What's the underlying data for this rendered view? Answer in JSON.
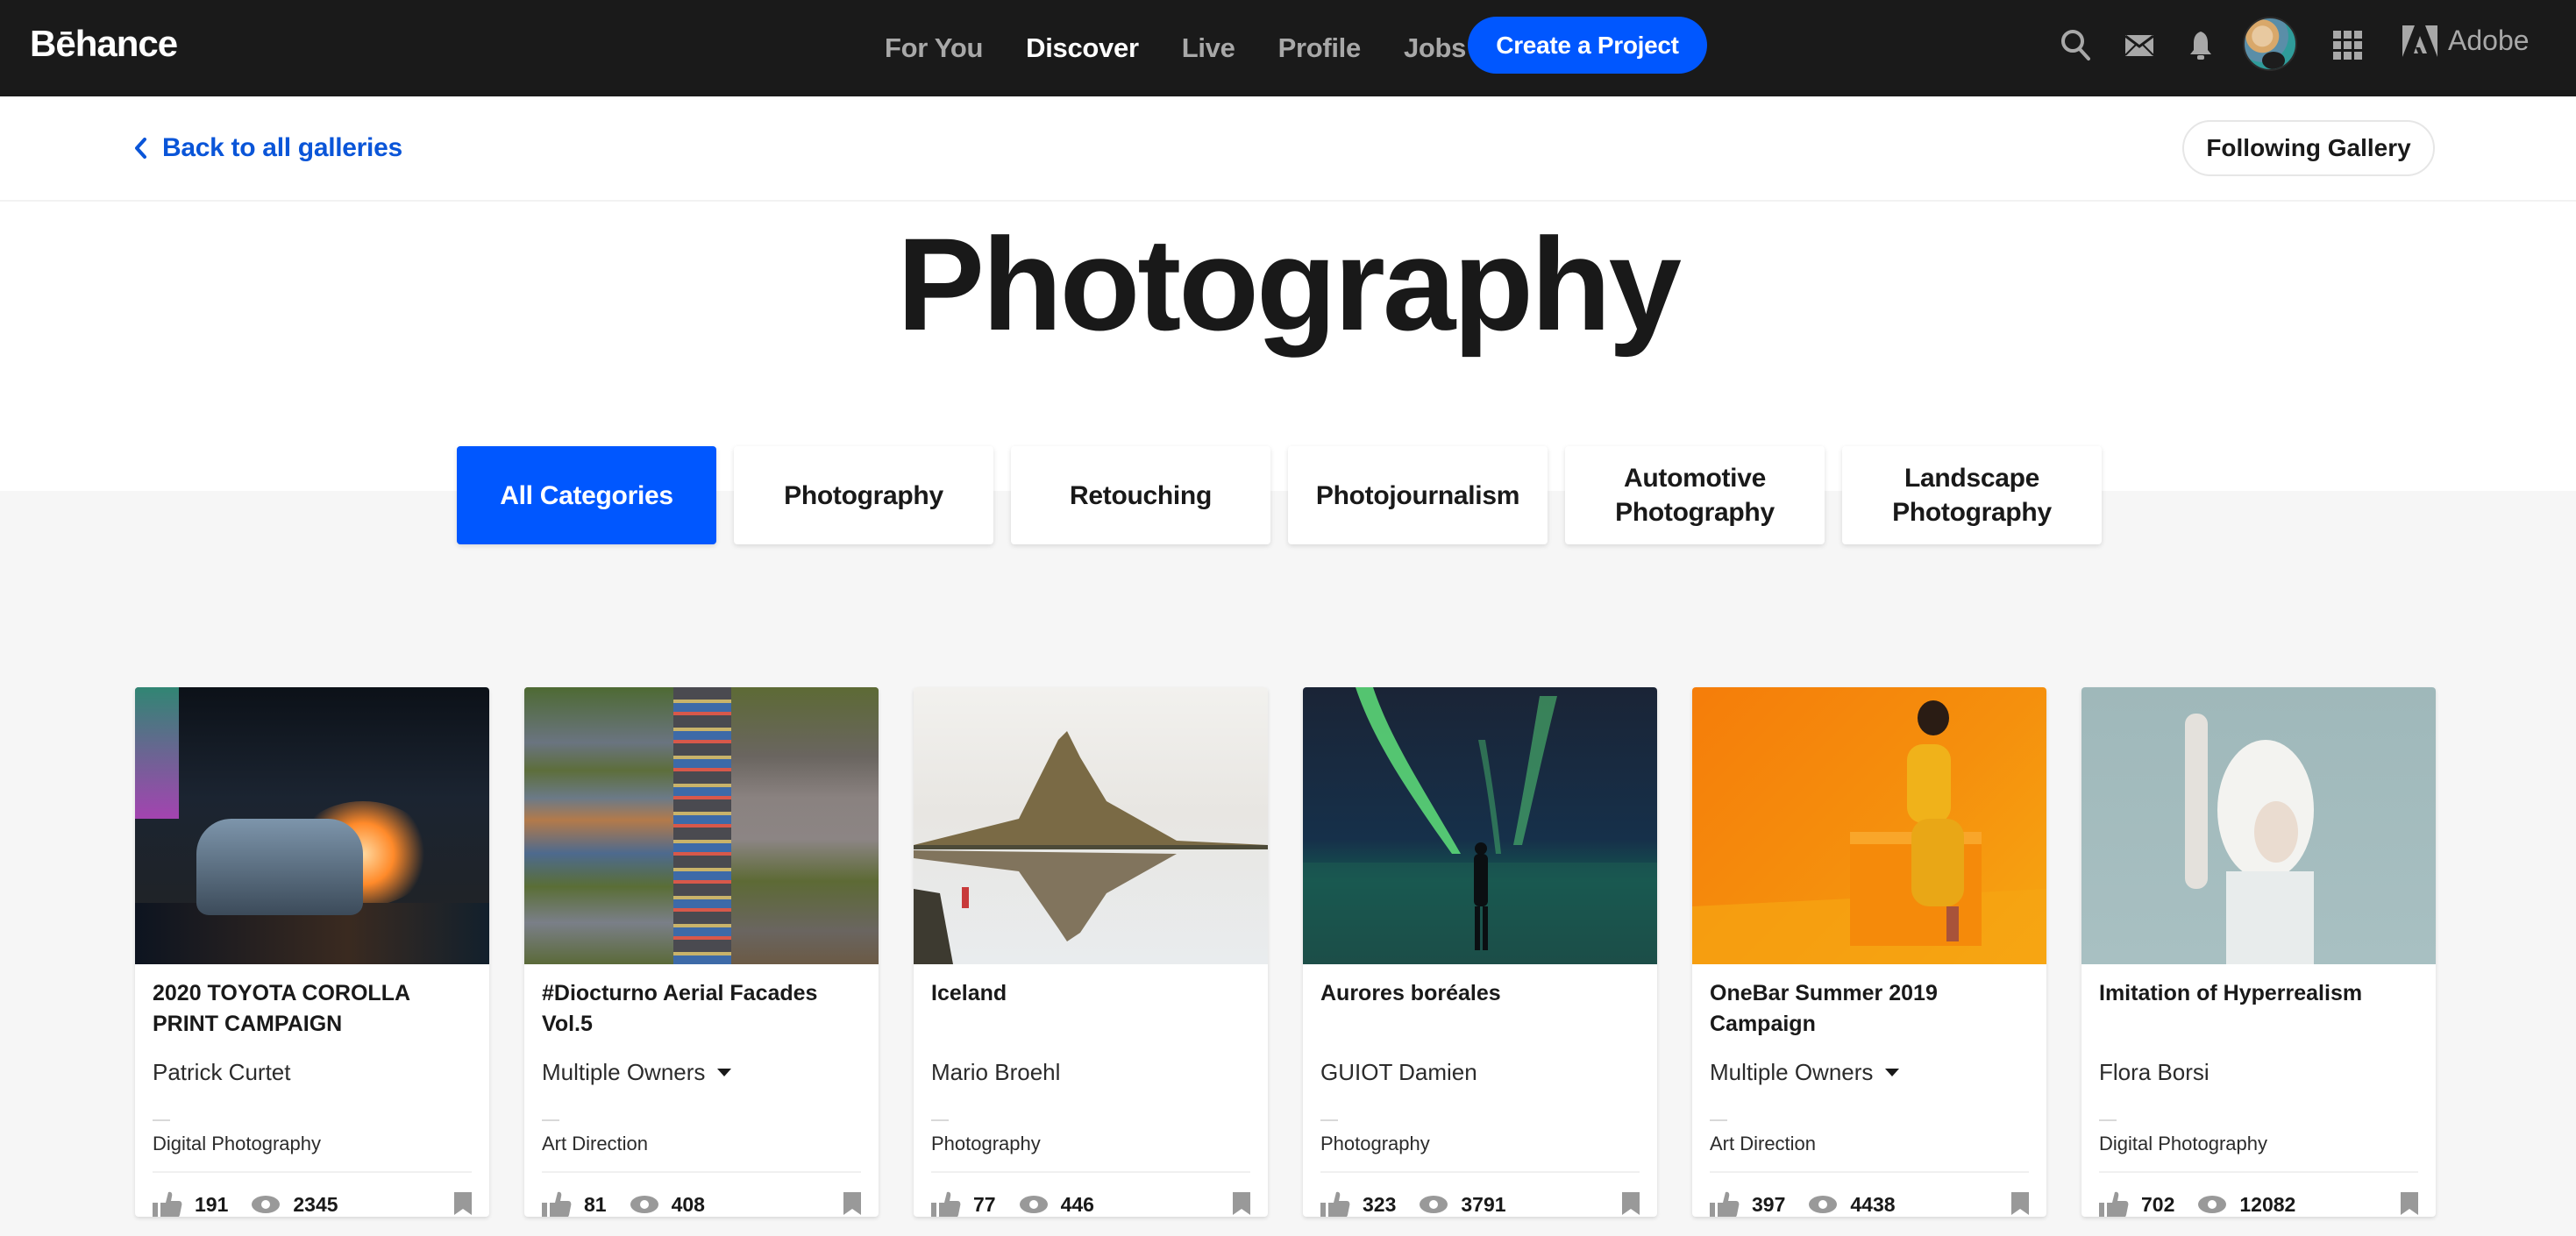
{
  "header": {
    "logo": "Bēhance",
    "nav": [
      {
        "label": "For You",
        "active": false
      },
      {
        "label": "Discover",
        "active": true
      },
      {
        "label": "Live",
        "active": false
      },
      {
        "label": "Profile",
        "active": false
      },
      {
        "label": "Jobs",
        "active": false
      }
    ],
    "create_button": "Create a Project",
    "icons": [
      "search-icon",
      "mail-icon",
      "bell-icon",
      "avatar",
      "apps-grid-icon",
      "adobe-logo-icon"
    ],
    "adobe_label": "Adobe",
    "accent_color": "#0057ff"
  },
  "subheader": {
    "back_link": "Back to all galleries",
    "following_button": "Following Gallery"
  },
  "page": {
    "title": "Photography"
  },
  "category_tabs": [
    {
      "label": "All Categories",
      "active": true
    },
    {
      "label": "Photography",
      "active": false
    },
    {
      "label": "Retouching",
      "active": false
    },
    {
      "label": "Photojournalism",
      "active": false
    },
    {
      "label": "Automotive Photography",
      "active": false
    },
    {
      "label": "Landscape Photography",
      "active": false
    }
  ],
  "projects": [
    {
      "title": "2020 TOYOTA COROLLA PRINT CAMPAIGN",
      "owner": "Patrick Curtet",
      "multiple_owners": false,
      "field": "Digital Photography",
      "appreciations": "191",
      "views": "2345",
      "image": "night city car"
    },
    {
      "title": "#Diocturno Aerial Facades Vol.5",
      "owner": "Multiple Owners",
      "multiple_owners": true,
      "field": "Art Direction",
      "appreciations": "81",
      "views": "408",
      "image": "aerial highway"
    },
    {
      "title": "Iceland",
      "owner": "Mario Broehl",
      "multiple_owners": false,
      "field": "Photography",
      "appreciations": "77",
      "views": "446",
      "image": "mountain reflection"
    },
    {
      "title": "Aurores boréales",
      "owner": "GUIOT Damien",
      "multiple_owners": false,
      "field": "Photography",
      "appreciations": "323",
      "views": "3791",
      "image": "northern lights"
    },
    {
      "title": "OneBar Summer 2019 Campaign",
      "owner": "Multiple Owners",
      "multiple_owners": true,
      "field": "Art Direction",
      "appreciations": "397",
      "views": "4438",
      "image": "orange studio portrait"
    },
    {
      "title": "Imitation of Hyperrealism",
      "owner": "Flora Borsi",
      "multiple_owners": false,
      "field": "Digital Photography",
      "appreciations": "702",
      "views": "12082",
      "image": "foam portrait"
    }
  ]
}
